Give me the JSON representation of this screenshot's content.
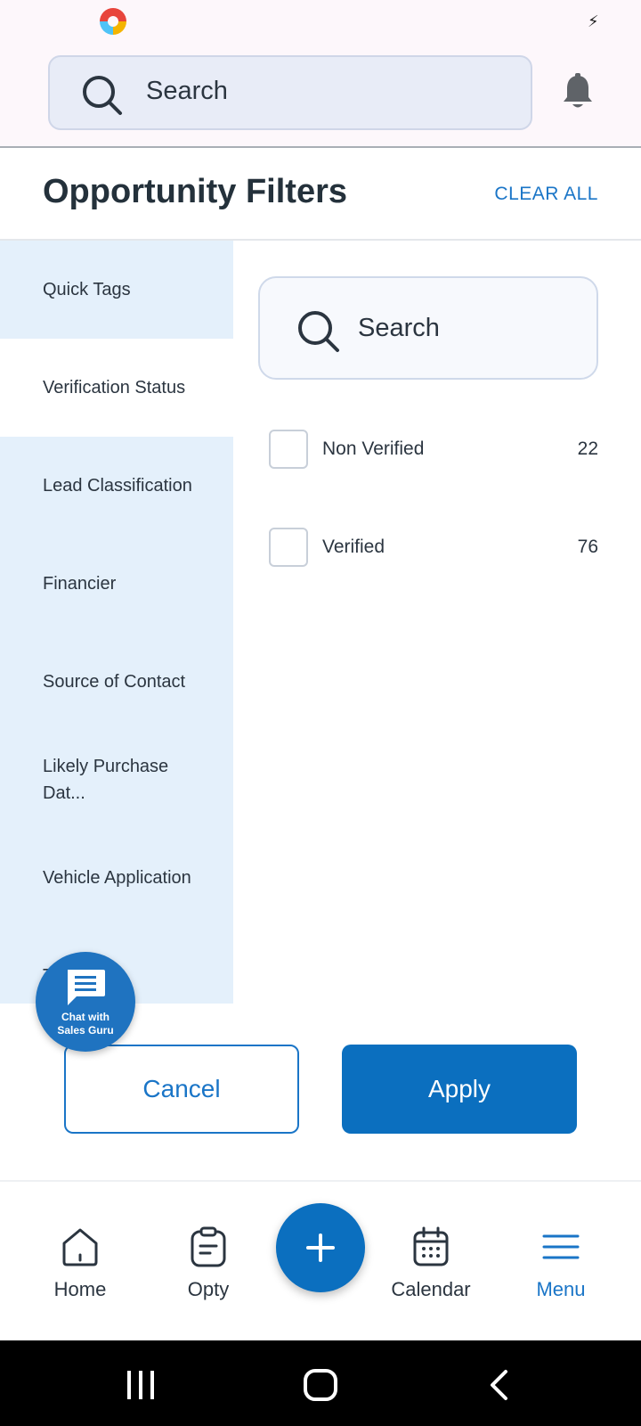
{
  "top": {
    "search_placeholder": "Search"
  },
  "header": {
    "title": "Opportunity Filters",
    "clear_all": "CLEAR ALL"
  },
  "categories": [
    {
      "label": "Quick Tags"
    },
    {
      "label": "Verification Status"
    },
    {
      "label": "Lead Classification"
    },
    {
      "label": "Financier"
    },
    {
      "label": "Source of Contact"
    },
    {
      "label": "Likely Purchase Dat..."
    },
    {
      "label": "Vehicle Application"
    },
    {
      "label": "T"
    }
  ],
  "filter": {
    "search_placeholder": "Search",
    "options": [
      {
        "label": "Non Verified",
        "count": "22"
      },
      {
        "label": "Verified",
        "count": "76"
      }
    ]
  },
  "chat": {
    "line1": "Chat with",
    "line2": "Sales Guru"
  },
  "actions": {
    "cancel": "Cancel",
    "apply": "Apply"
  },
  "nav": {
    "home": "Home",
    "opty": "Opty",
    "calendar": "Calendar",
    "menu": "Menu"
  },
  "colors": {
    "accent": "#0b6fbf",
    "sidebar_bg": "#e4f0fb"
  }
}
